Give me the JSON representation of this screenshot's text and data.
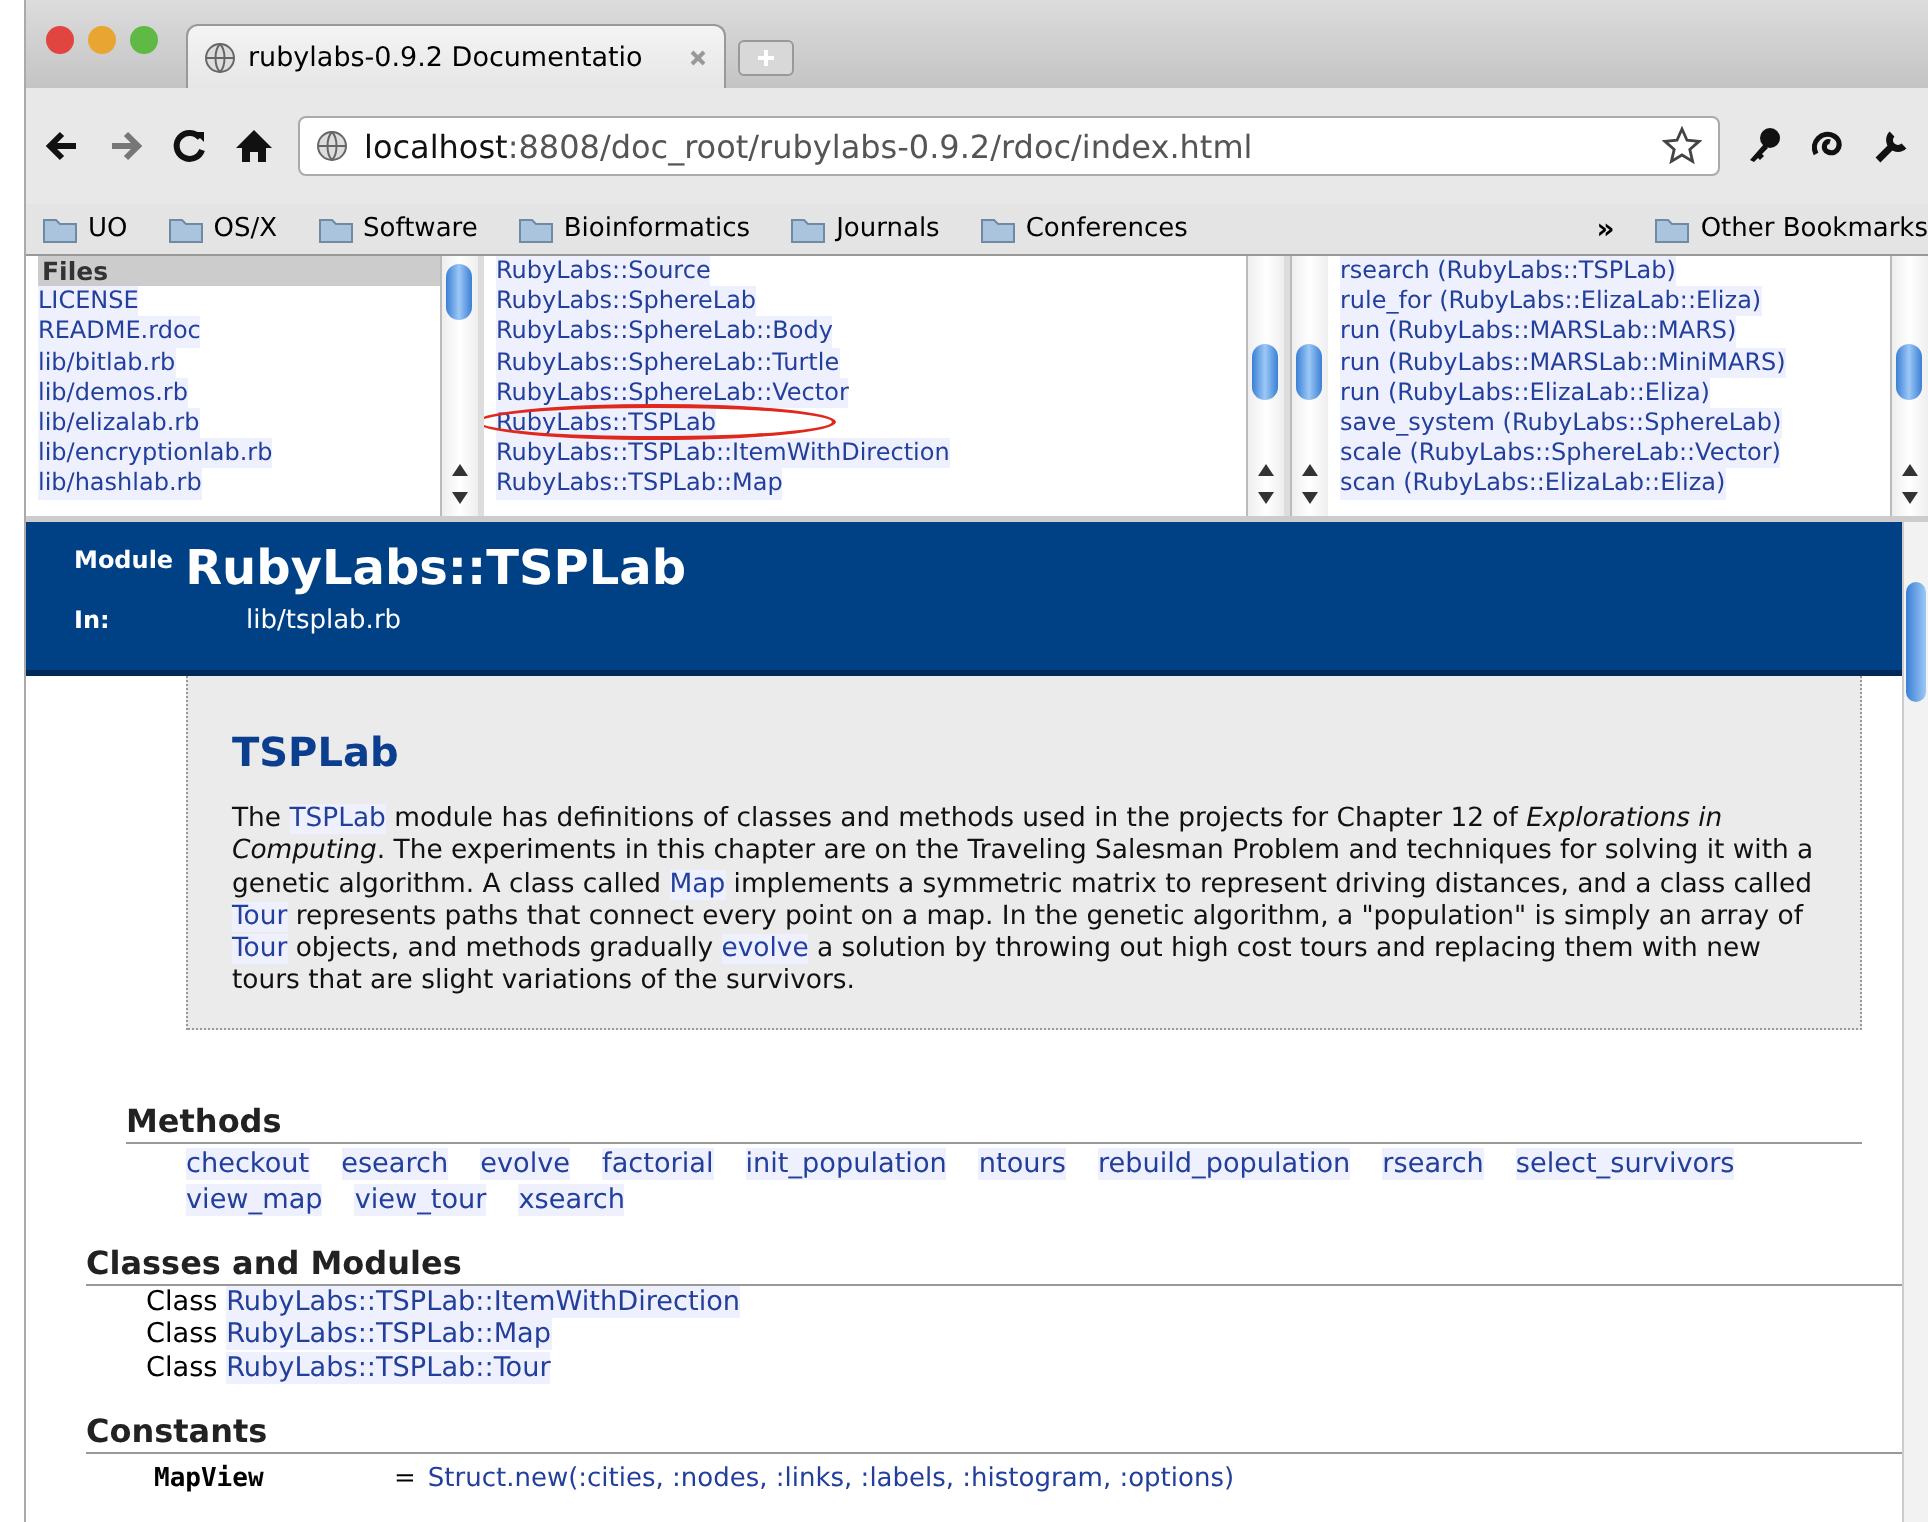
{
  "window": {
    "tabs": [
      {
        "title": "rubylabs-0.9.2 Documentatio",
        "selected": true
      }
    ],
    "address": {
      "host": "localhost",
      "rest": ":8808/doc_root/rubylabs-0.9.2/rdoc/index.html"
    }
  },
  "bookmarks": [
    "UO",
    "OS/X",
    "Software",
    "Bioinformatics",
    "Journals",
    "Conferences"
  ],
  "bookmarks_overflow": "»",
  "other_bookmarks": "Other Bookmarks",
  "frames": {
    "files": {
      "heading": "Files",
      "items": [
        "LICENSE",
        "README.rdoc",
        "lib/bitlab.rb",
        "lib/demos.rb",
        "lib/elizalab.rb",
        "lib/encryptionlab.rb",
        "lib/hashlab.rb"
      ]
    },
    "classes": {
      "items": [
        {
          "label": "RubyLabs::Source",
          "circled": false
        },
        {
          "label": "RubyLabs::SphereLab",
          "circled": false
        },
        {
          "label": "RubyLabs::SphereLab::Body",
          "circled": false
        },
        {
          "label": "RubyLabs::SphereLab::Turtle",
          "circled": false
        },
        {
          "label": "RubyLabs::SphereLab::Vector",
          "circled": false
        },
        {
          "label": "RubyLabs::TSPLab",
          "circled": true
        },
        {
          "label": "RubyLabs::TSPLab::ItemWithDirection",
          "circled": false
        },
        {
          "label": "RubyLabs::TSPLab::Map",
          "circled": false
        }
      ]
    },
    "methods": {
      "items": [
        "rsearch (RubyLabs::TSPLab)",
        "rule_for (RubyLabs::ElizaLab::Eliza)",
        "run (RubyLabs::MARSLab::MARS)",
        "run (RubyLabs::MARSLab::MiniMARS)",
        "run (RubyLabs::ElizaLab::Eliza)",
        "save_system (RubyLabs::SphereLab)",
        "scale (RubyLabs::SphereLab::Vector)",
        "scan (RubyLabs::ElizaLab::Eliza)"
      ]
    }
  },
  "header": {
    "kind_label": "Module",
    "title": "RubyLabs::TSPLab",
    "in_label": "In:",
    "file": "lib/tsplab.rb"
  },
  "description": {
    "title": "TSPLab",
    "segments": [
      {
        "kind": "text",
        "text": "The "
      },
      {
        "kind": "link",
        "text": "TSPLab"
      },
      {
        "kind": "text",
        "text": " module has definitions of classes and methods used in the projects for Chapter 12 of *Explorations in Computing*. The experiments in this chapter are on the Traveling Salesman Problem and techniques for solving it with a genetic algorithm. A class called "
      },
      {
        "kind": "link",
        "text": "Map"
      },
      {
        "kind": "text",
        "text": " implements a symmetric matrix to represent driving distances, and a class called "
      },
      {
        "kind": "link",
        "text": "Tour"
      },
      {
        "kind": "text",
        "text": " represents paths that connect every point on a map. In the genetic algorithm, a \"population\" is simply an array of "
      },
      {
        "kind": "link",
        "text": "Tour"
      },
      {
        "kind": "text",
        "text": " objects, and methods gradually "
      },
      {
        "kind": "link",
        "text": "evolve"
      },
      {
        "kind": "text",
        "text": " a solution by throwing out high cost tours and replacing them with new tours that are slight variations of the survivors."
      }
    ]
  },
  "methods": {
    "heading": "Methods",
    "items": [
      "checkout",
      "esearch",
      "evolve",
      "factorial",
      "init_population",
      "ntours",
      "rebuild_population",
      "rsearch",
      "select_survivors",
      "view_map",
      "view_tour",
      "xsearch"
    ]
  },
  "classes_and_modules": {
    "heading": "Classes and Modules",
    "items": [
      {
        "prefix": "Class",
        "name": "RubyLabs::TSPLab::ItemWithDirection"
      },
      {
        "prefix": "Class",
        "name": "RubyLabs::TSPLab::Map"
      },
      {
        "prefix": "Class",
        "name": "RubyLabs::TSPLab::Tour"
      }
    ]
  },
  "constants": {
    "heading": "Constants",
    "items": [
      {
        "name": "MapView",
        "eq": "=",
        "value": "Struct.new(:cities, :nodes, :links, :labels, :histogram, :options)"
      }
    ]
  }
}
